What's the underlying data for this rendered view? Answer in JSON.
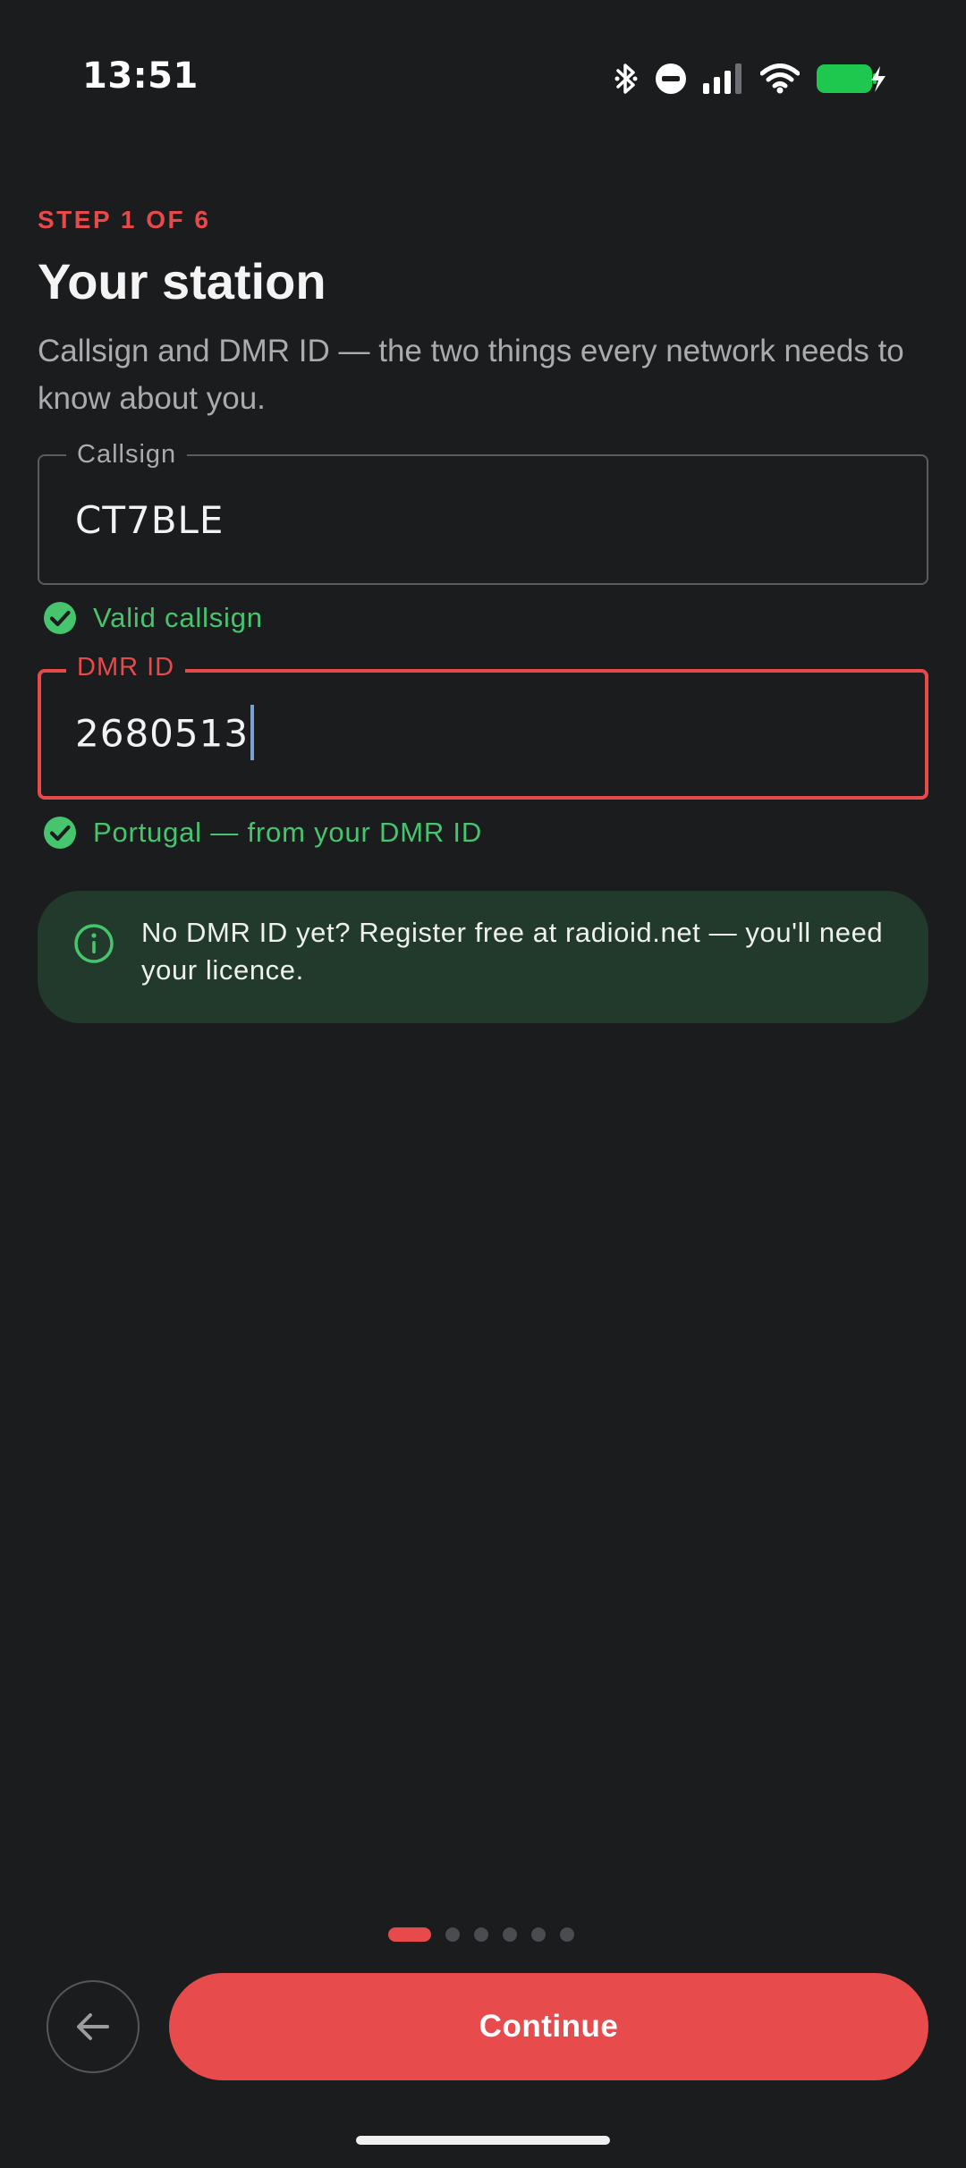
{
  "status_bar": {
    "time": "13:51",
    "icons": [
      "bluetooth-icon",
      "do-not-disturb-icon",
      "cellular-signal-icon",
      "wifi-icon",
      "battery-charging-icon"
    ],
    "battery_color": "#1ec74d"
  },
  "header": {
    "step": "STEP 1 OF 6",
    "title": "Your station",
    "subtitle": "Callsign and DMR ID — the two things every network needs to know about you."
  },
  "form": {
    "callsign": {
      "label": "Callsign",
      "value": "CT7BLE",
      "helper": "Valid callsign"
    },
    "dmr_id": {
      "label": "DMR ID",
      "value": "2680513",
      "helper": "Portugal — from your DMR ID"
    }
  },
  "info": {
    "text": "No DMR ID yet? Register free at radioid.net — you'll need your licence."
  },
  "pager": {
    "total": 6,
    "current": 1
  },
  "actions": {
    "continue_label": "Continue"
  },
  "colors": {
    "accent": "#e8494b",
    "success": "#46c46e",
    "background": "#1b1c1e",
    "info_card": "#213a2b"
  }
}
